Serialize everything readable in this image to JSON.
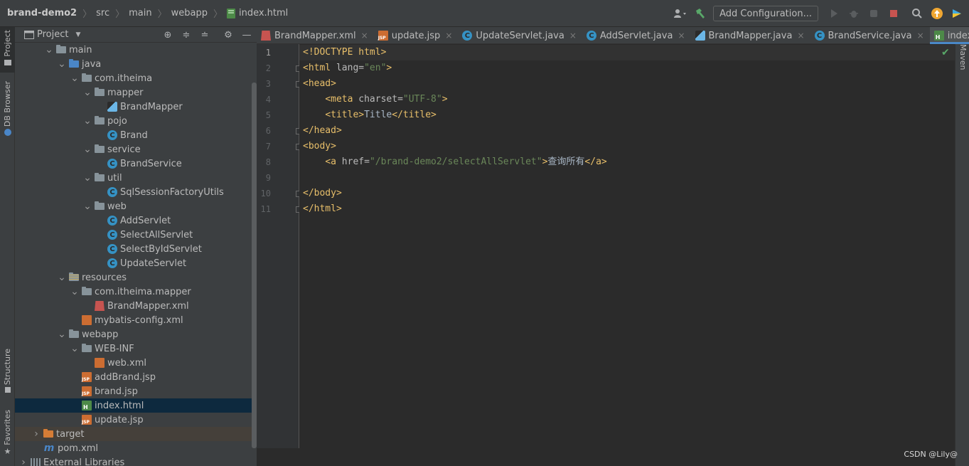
{
  "breadcrumb": [
    "brand-demo2",
    "src",
    "main",
    "webapp",
    "index.html"
  ],
  "toolbar": {
    "add_configuration": "Add Configuration..."
  },
  "left_strip": {
    "project": "Project",
    "db_browser": "DB Browser",
    "structure": "Structure",
    "favorites": "Favorites"
  },
  "right_strip": {
    "maven": "Maven"
  },
  "project_panel": {
    "title": "Project",
    "tree": [
      {
        "label": "main",
        "icon": "folder",
        "depth": 2,
        "expanded": true
      },
      {
        "label": "java",
        "icon": "folder-source",
        "depth": 3,
        "expanded": true
      },
      {
        "label": "com.itheima",
        "icon": "package",
        "depth": 4,
        "expanded": true
      },
      {
        "label": "mapper",
        "icon": "package",
        "depth": 5,
        "expanded": true
      },
      {
        "label": "BrandMapper",
        "icon": "mapper-interface",
        "depth": 6
      },
      {
        "label": "pojo",
        "icon": "package",
        "depth": 5,
        "expanded": true
      },
      {
        "label": "Brand",
        "icon": "class",
        "depth": 6
      },
      {
        "label": "service",
        "icon": "package",
        "depth": 5,
        "expanded": true
      },
      {
        "label": "BrandService",
        "icon": "class",
        "depth": 6
      },
      {
        "label": "util",
        "icon": "package",
        "depth": 5,
        "expanded": true
      },
      {
        "label": "SqlSessionFactoryUtils",
        "icon": "class",
        "depth": 6
      },
      {
        "label": "web",
        "icon": "package",
        "depth": 5,
        "expanded": true
      },
      {
        "label": "AddServlet",
        "icon": "class",
        "depth": 6
      },
      {
        "label": "SelectAllServlet",
        "icon": "class",
        "depth": 6
      },
      {
        "label": "SelectByIdServlet",
        "icon": "class",
        "depth": 6
      },
      {
        "label": "UpdateServlet",
        "icon": "class",
        "depth": 6
      },
      {
        "label": "resources",
        "icon": "folder-resources",
        "depth": 3,
        "expanded": true
      },
      {
        "label": "com.itheima.mapper",
        "icon": "folder",
        "depth": 4,
        "expanded": true
      },
      {
        "label": "BrandMapper.xml",
        "icon": "mybatis-xml",
        "depth": 5
      },
      {
        "label": "mybatis-config.xml",
        "icon": "xml-config",
        "depth": 4
      },
      {
        "label": "webapp",
        "icon": "folder-web",
        "depth": 3,
        "expanded": true
      },
      {
        "label": "WEB-INF",
        "icon": "folder",
        "depth": 4,
        "expanded": true
      },
      {
        "label": "web.xml",
        "icon": "xml-config",
        "depth": 5
      },
      {
        "label": "addBrand.jsp",
        "icon": "jsp",
        "depth": 4
      },
      {
        "label": "brand.jsp",
        "icon": "jsp",
        "depth": 4
      },
      {
        "label": "index.html",
        "icon": "html",
        "depth": 4,
        "selected": true
      },
      {
        "label": "update.jsp",
        "icon": "jsp",
        "depth": 4
      },
      {
        "label": "target",
        "icon": "folder-excluded",
        "depth": 1,
        "expanded": false,
        "excluded": true
      },
      {
        "label": "pom.xml",
        "icon": "maven-pom",
        "depth": 1
      },
      {
        "label": "External Libraries",
        "icon": "libraries",
        "depth": 0,
        "expanded": false
      }
    ]
  },
  "tabs": [
    {
      "label": "BrandMapper.xml",
      "icon": "mybatis-xml"
    },
    {
      "label": "update.jsp",
      "icon": "jsp"
    },
    {
      "label": "UpdateServlet.java",
      "icon": "class"
    },
    {
      "label": "AddServlet.java",
      "icon": "class"
    },
    {
      "label": "BrandMapper.java",
      "icon": "mapper-interface"
    },
    {
      "label": "BrandService.java",
      "icon": "class"
    },
    {
      "label": "index.html",
      "icon": "html",
      "active": true
    }
  ],
  "editor": {
    "current_line": 1,
    "lines": [
      {
        "n": "1",
        "tokens": [
          [
            "dt",
            "<!DOCTYPE html>"
          ]
        ]
      },
      {
        "n": "2",
        "tokens": [
          [
            "tg",
            "<html "
          ],
          [
            "at",
            "lang="
          ],
          [
            "av",
            "\"en\""
          ],
          [
            "tg",
            ">"
          ]
        ]
      },
      {
        "n": "3",
        "tokens": [
          [
            "tg",
            "<head>"
          ]
        ]
      },
      {
        "n": "4",
        "tokens": [
          [
            "tx",
            "    "
          ],
          [
            "tg",
            "<meta "
          ],
          [
            "at",
            "charset="
          ],
          [
            "av",
            "\"UTF-8\""
          ],
          [
            "tg",
            ">"
          ]
        ]
      },
      {
        "n": "5",
        "tokens": [
          [
            "tx",
            "    "
          ],
          [
            "tg",
            "<title>"
          ],
          [
            "tx",
            "Title"
          ],
          [
            "tg",
            "</title>"
          ]
        ]
      },
      {
        "n": "6",
        "tokens": [
          [
            "tg",
            "</head>"
          ]
        ]
      },
      {
        "n": "7",
        "tokens": [
          [
            "tg",
            "<body>"
          ]
        ]
      },
      {
        "n": "8",
        "tokens": [
          [
            "tx",
            "    "
          ],
          [
            "tg",
            "<a "
          ],
          [
            "at",
            "href="
          ],
          [
            "av",
            "\"/brand-demo2/selectAllServlet\""
          ],
          [
            "tg",
            ">"
          ],
          [
            "tx",
            "查询所有"
          ],
          [
            "tg",
            "</a>"
          ]
        ]
      },
      {
        "n": "9",
        "tokens": []
      },
      {
        "n": "10",
        "tokens": [
          [
            "tg",
            "</body>"
          ]
        ]
      },
      {
        "n": "11",
        "tokens": [
          [
            "tg",
            "</html>"
          ]
        ]
      }
    ],
    "fold_lines": [
      2,
      3,
      6,
      7,
      10,
      11
    ]
  },
  "watermark": "CSDN @Lily@"
}
